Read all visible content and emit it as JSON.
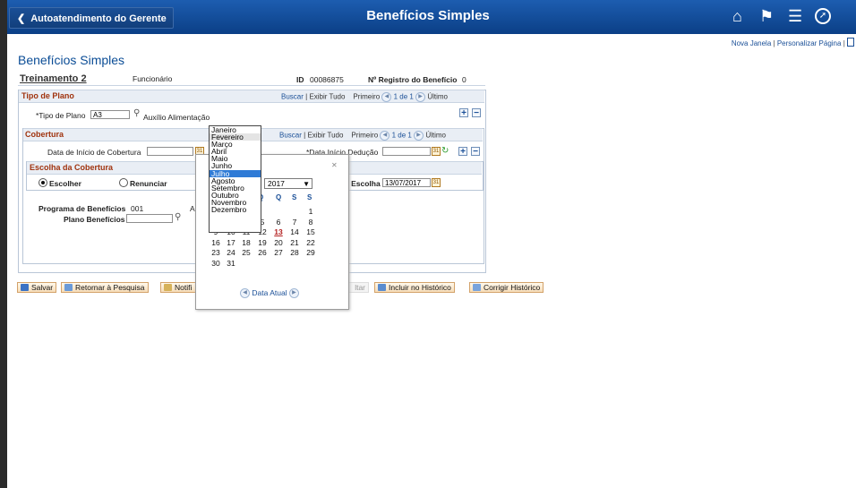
{
  "header": {
    "back_label": "Autoatendimento do Gerente",
    "title": "Benefícios Simples",
    "icons": [
      "home-icon",
      "flag-icon",
      "menu-icon",
      "compass-icon"
    ]
  },
  "top_links": {
    "new_window": "Nova Janela",
    "personalize": "Personalizar Página"
  },
  "page": {
    "title": "Benefícios Simples"
  },
  "employee": {
    "name": "Treinamento 2",
    "role": "Funcionário",
    "id_label": "ID",
    "id_value": "00086875",
    "reg_label": "Nº Registro do Benefício",
    "reg_value": "0"
  },
  "plan_section": {
    "title": "Tipo de Plano",
    "find": "Buscar",
    "view_all": "Exibir Tudo",
    "first": "Primeiro",
    "range": "1 de 1",
    "last": "Último",
    "plan_type_label": "*Tipo de Plano",
    "plan_type_value": "A3",
    "plan_type_desc": "Auxílio Alimentação"
  },
  "coverage_section": {
    "title": "Cobertura",
    "find": "Buscar",
    "view_all": "Exibir Tudo",
    "first": "Primeiro",
    "range": "1 de 1",
    "last": "Último",
    "start_label": "Data de Início de Cobertura",
    "start_value": "",
    "deduction_label": "*Data Início Dedução",
    "deduction_value": ""
  },
  "choice_section": {
    "title": "Escolha da Cobertura",
    "elect_label": "Escolher",
    "waive_label": "Renunciar",
    "election_date_label": "a Escolha",
    "election_date_value": "13/07/2017",
    "benefit_program_label": "Programa de Benefícios",
    "benefit_program_value": "001",
    "benefit_plan_label": "Plano Benefícios",
    "benefit_plan_value": "",
    "partial_letter": "A"
  },
  "calendar": {
    "year": "2017",
    "weekdays_visible": [
      "Q",
      "Q",
      "S",
      "S"
    ],
    "day_rows": [
      [
        "",
        "",
        "",
        "",
        "",
        "",
        "1"
      ],
      [
        "2",
        "3",
        "4",
        "5",
        "6",
        "7",
        "8"
      ],
      [
        "9",
        "10",
        "11",
        "12",
        "13",
        "14",
        "15"
      ],
      [
        "16",
        "17",
        "18",
        "19",
        "20",
        "21",
        "22"
      ],
      [
        "23",
        "24",
        "25",
        "26",
        "27",
        "28",
        "29"
      ],
      [
        "30",
        "31",
        "",
        "",
        "",
        "",
        ""
      ]
    ],
    "today": "13",
    "current_date_label": "Data Atual"
  },
  "month_list": {
    "options": [
      "Janeiro",
      "Fevereiro",
      "Março",
      "Abril",
      "Maio",
      "Junho",
      "Julho",
      "Agosto",
      "Setembro",
      "Outubro",
      "Novembro",
      "Dezembro"
    ],
    "hovered": "Fevereiro",
    "selected": "Julho"
  },
  "buttons": {
    "save": "Salvar",
    "return_search": "Retornar à Pesquisa",
    "notify": "Notifi",
    "update": "ltar",
    "include_history": "Incluir no Histórico",
    "correct_history": "Corrigir Histórico"
  }
}
